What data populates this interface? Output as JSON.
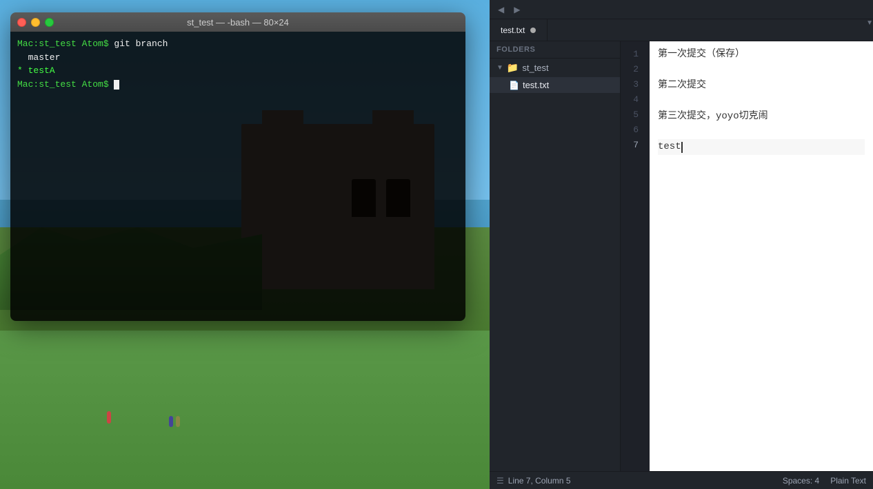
{
  "desktop": {
    "bg_description": "outdoor scenery - sky, water, castle/building, grass"
  },
  "terminal": {
    "title": "st_test — -bash — 80×24",
    "lines": [
      {
        "type": "prompt",
        "text": "Mac:st_test Atom$ git branch"
      },
      {
        "type": "output-white",
        "text": "  master"
      },
      {
        "type": "output-green",
        "text": "* testA"
      },
      {
        "type": "prompt-cursor",
        "text": "Mac:st_test Atom$ "
      }
    ],
    "traffic_lights": [
      "close",
      "minimize",
      "maximize"
    ]
  },
  "atom": {
    "toolbar": {
      "nav_prev": "◀",
      "nav_next": "▶"
    },
    "tab": {
      "filename": "test.txt",
      "modified": true
    },
    "sidebar": {
      "folders_label": "FOLDERS",
      "folder_name": "st_test",
      "file_name": "test.txt"
    },
    "editor": {
      "lines": [
        {
          "number": 1,
          "text": "第一次提交（保存）"
        },
        {
          "number": 2,
          "text": ""
        },
        {
          "number": 3,
          "text": "第二次提交"
        },
        {
          "number": 4,
          "text": ""
        },
        {
          "number": 5,
          "text": "第三次提交，yoyo切克闹"
        },
        {
          "number": 6,
          "text": ""
        },
        {
          "number": 7,
          "text": "test",
          "cursor": true
        }
      ]
    },
    "statusbar": {
      "cursor_icon": "☰",
      "position": "Line 7, Column 5",
      "spaces_label": "Spaces: 4",
      "language": "Plain Text"
    }
  }
}
